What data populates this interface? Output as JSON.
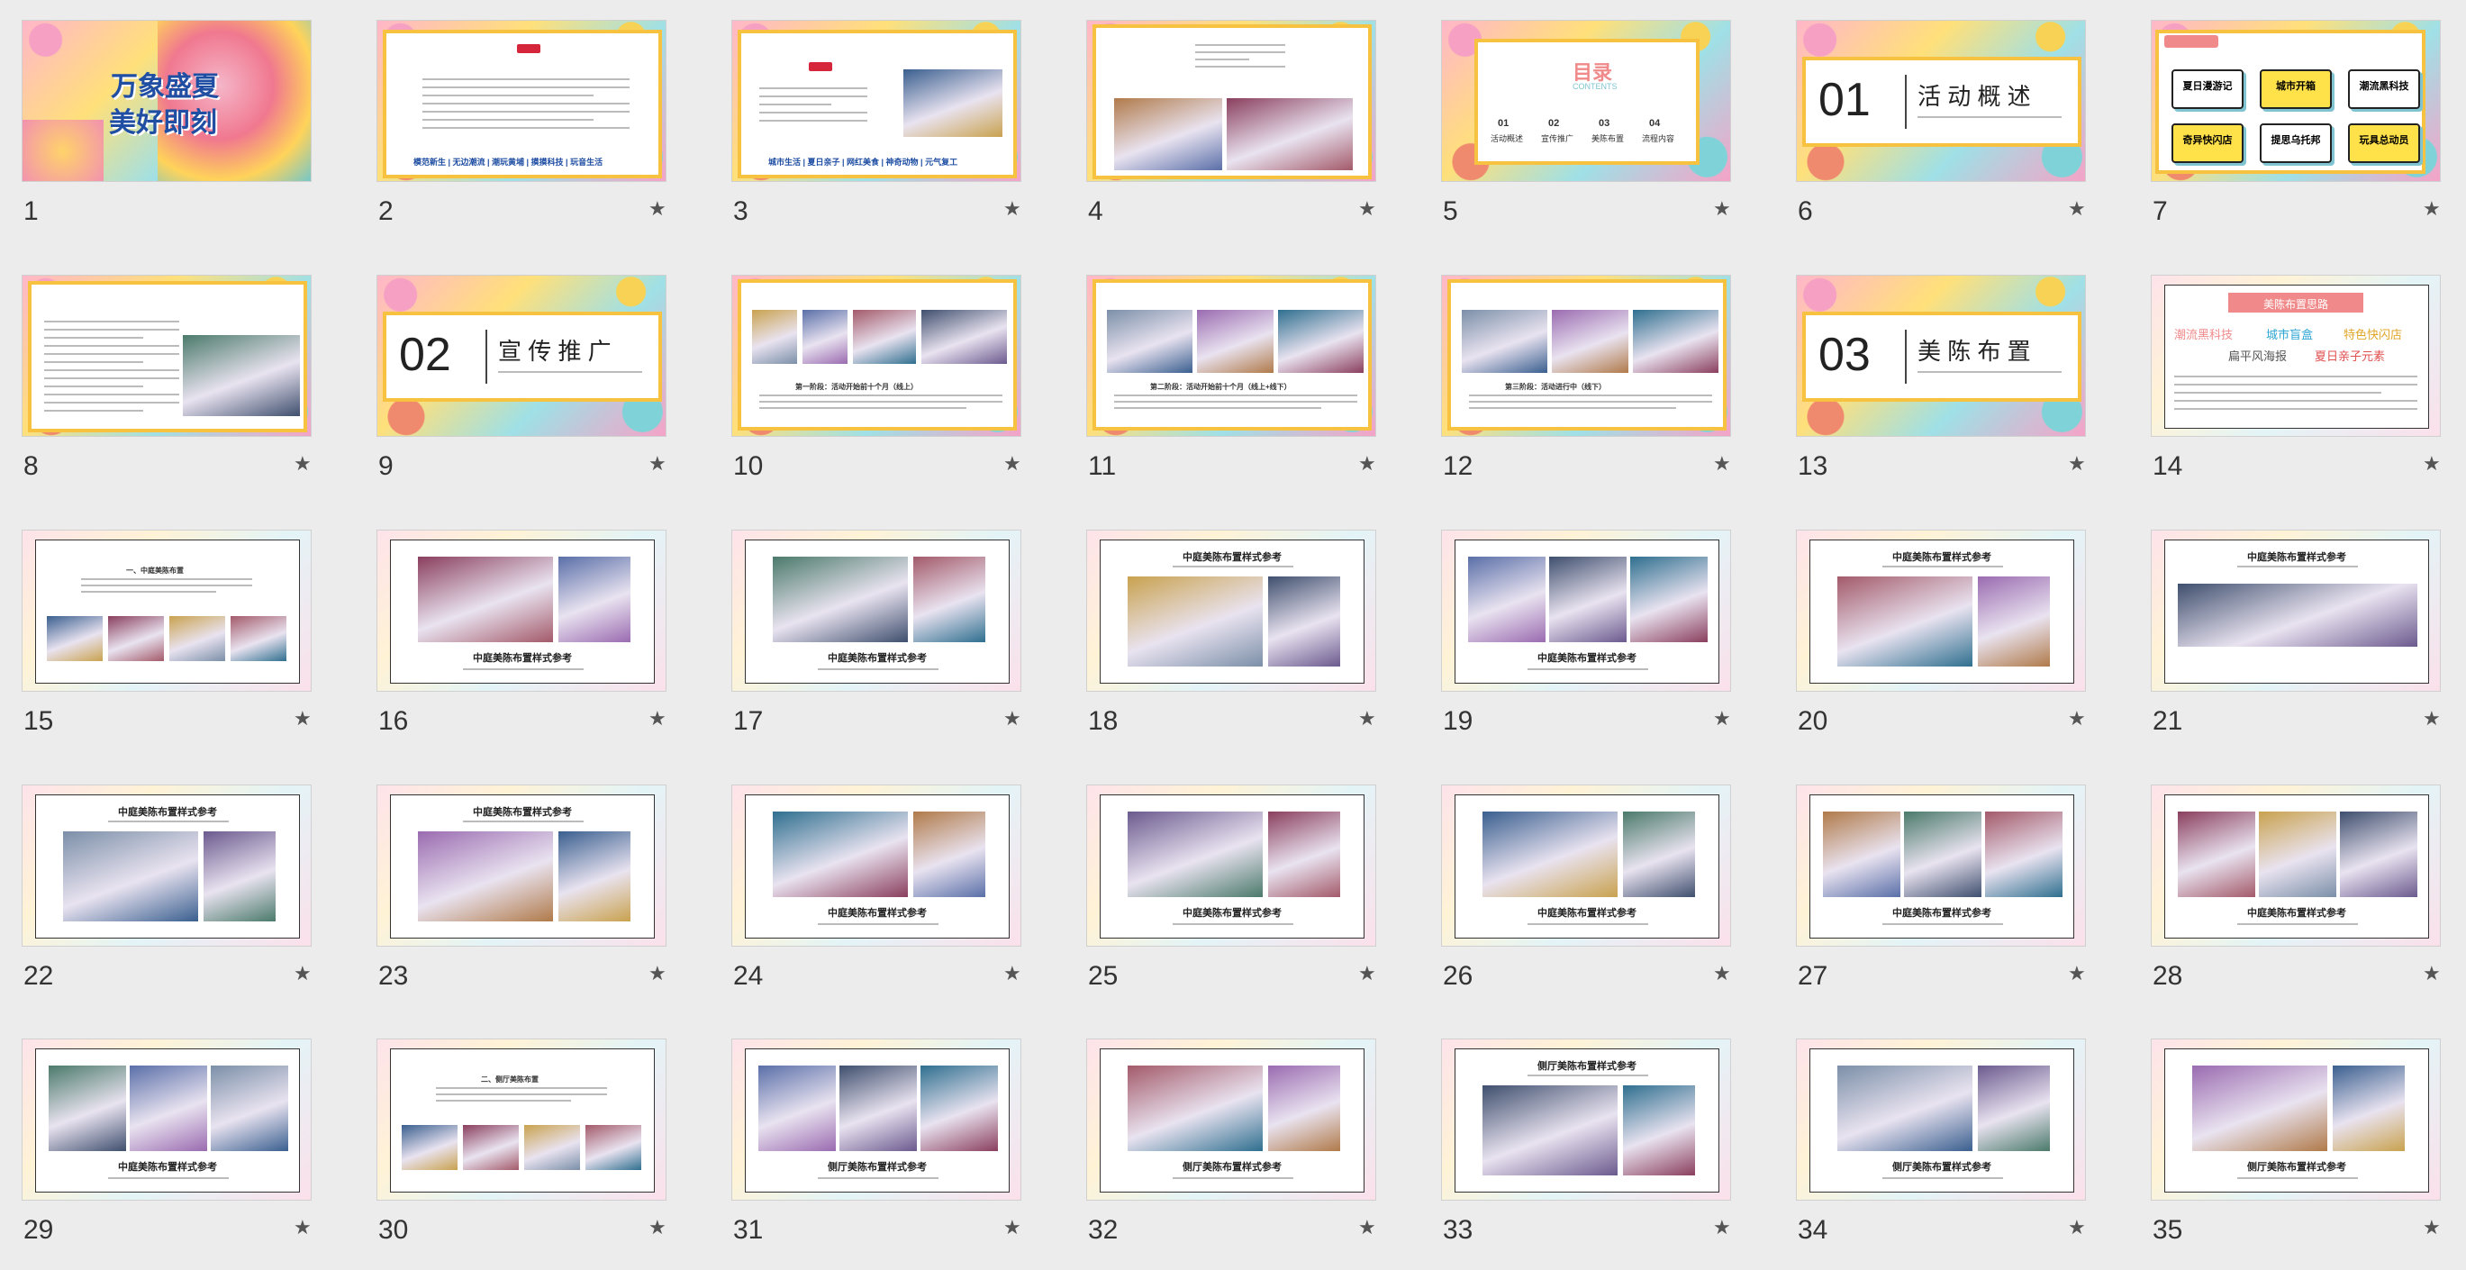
{
  "slides": [
    {
      "num": "1",
      "kind": "cover",
      "title1": "万象盛夏",
      "title2": "美好即刻"
    },
    {
      "num": "2",
      "kind": "textnav",
      "nav": "模范新生 | 无边潮流 | 潮玩黄埔 | 摸摸科技 | 玩音生活"
    },
    {
      "num": "3",
      "kind": "textimg",
      "nav": "城市生活 | 夏日亲子 | 网红美食 | 神奇动物 | 元气复工"
    },
    {
      "num": "4",
      "kind": "twoimg"
    },
    {
      "num": "5",
      "kind": "toc",
      "title": "目录",
      "sub": "CONTENTS",
      "items": [
        {
          "n": "01",
          "t": "活动概述"
        },
        {
          "n": "02",
          "t": "宣传推广"
        },
        {
          "n": "03",
          "t": "美陈布置"
        },
        {
          "n": "04",
          "t": "流程内容"
        }
      ]
    },
    {
      "num": "6",
      "kind": "section",
      "n": "01",
      "title": "活 动 概 述"
    },
    {
      "num": "7",
      "kind": "tags",
      "items": [
        "夏日漫游记",
        "城市开箱",
        "潮流黑科技",
        "奇异快闪店",
        "提思乌托邦",
        "玩具总动员"
      ]
    },
    {
      "num": "8",
      "kind": "textphoto"
    },
    {
      "num": "9",
      "kind": "section",
      "n": "02",
      "title": "宣 传 推 广"
    },
    {
      "num": "10",
      "kind": "fourimg",
      "cap": "第一阶段：活动开始前十个月（线上）"
    },
    {
      "num": "11",
      "kind": "threeimg",
      "cap": "第二阶段：活动开始前十个月（线上+线下）"
    },
    {
      "num": "12",
      "kind": "threeimg",
      "cap": "第三阶段：活动进行中（线下）"
    },
    {
      "num": "13",
      "kind": "section",
      "n": "03",
      "title": "美 陈 布 置"
    },
    {
      "num": "14",
      "kind": "ideas",
      "title": "美陈布置思路",
      "w1": "潮流黑科技",
      "w2": "城市盲盒",
      "w3": "特色快闪店",
      "w4": "扁平风海报",
      "w5": "夏日亲子元素"
    },
    {
      "num": "15",
      "kind": "fourimgdeco",
      "cap": "一、中庭美陈布置"
    },
    {
      "num": "16",
      "kind": "ref",
      "cap": "中庭美陈布置样式参考"
    },
    {
      "num": "17",
      "kind": "ref",
      "cap": "中庭美陈布置样式参考"
    },
    {
      "num": "18",
      "kind": "reftop",
      "cap": "中庭美陈布置样式参考"
    },
    {
      "num": "19",
      "kind": "ref3",
      "cap": "中庭美陈布置样式参考"
    },
    {
      "num": "20",
      "kind": "reftop",
      "cap": "中庭美陈布置样式参考"
    },
    {
      "num": "21",
      "kind": "reftop1",
      "cap": "中庭美陈布置样式参考"
    },
    {
      "num": "22",
      "kind": "reftop",
      "cap": "中庭美陈布置样式参考"
    },
    {
      "num": "23",
      "kind": "reftop",
      "cap": "中庭美陈布置样式参考"
    },
    {
      "num": "24",
      "kind": "ref",
      "cap": "中庭美陈布置样式参考"
    },
    {
      "num": "25",
      "kind": "ref",
      "cap": "中庭美陈布置样式参考"
    },
    {
      "num": "26",
      "kind": "ref",
      "cap": "中庭美陈布置样式参考"
    },
    {
      "num": "27",
      "kind": "ref3",
      "cap": "中庭美陈布置样式参考"
    },
    {
      "num": "28",
      "kind": "ref3",
      "cap": "中庭美陈布置样式参考"
    },
    {
      "num": "29",
      "kind": "ref3",
      "cap": "中庭美陈布置样式参考"
    },
    {
      "num": "30",
      "kind": "fourimgdeco",
      "cap": "二、侧厅美陈布置"
    },
    {
      "num": "31",
      "kind": "ref3",
      "cap": "侧厅美陈布置样式参考"
    },
    {
      "num": "32",
      "kind": "ref",
      "cap": "侧厅美陈布置样式参考"
    },
    {
      "num": "33",
      "kind": "reftop",
      "cap": "侧厅美陈布置样式参考"
    },
    {
      "num": "34",
      "kind": "ref",
      "cap": "侧厅美陈布置样式参考"
    },
    {
      "num": "35",
      "kind": "ref",
      "cap": "侧厅美陈布置样式参考"
    }
  ],
  "star_glyph": "★",
  "colors": {
    "accent_yellow": "#f7c23f",
    "accent_red": "#d6263b",
    "blue": "#1f4ea3",
    "bg": "#ececec"
  }
}
